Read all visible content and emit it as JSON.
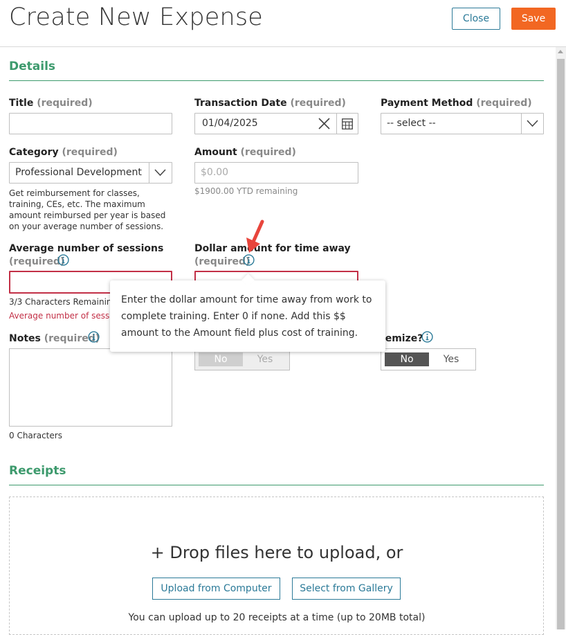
{
  "header": {
    "title": "Create New Expense",
    "close_label": "Close",
    "save_label": "Save"
  },
  "sections": {
    "details": "Details",
    "receipts": "Receipts"
  },
  "required_suffix": "(required)",
  "fields": {
    "title": {
      "label": "Title",
      "value": ""
    },
    "transaction_date": {
      "label": "Transaction Date",
      "value": "01/04/2025"
    },
    "payment_method": {
      "label": "Payment Method",
      "value": "-- select --"
    },
    "category": {
      "label": "Category",
      "value": "Professional Development",
      "help": "Get reimbursement for classes, training, CEs, etc. The maximum amount reimbursed per year is based on your average number of sessions."
    },
    "amount": {
      "label": "Amount",
      "placeholder": "$0.00",
      "remaining": "$1900.00 YTD remaining"
    },
    "avg_sessions": {
      "label": "Average number of sessions",
      "value": "",
      "char_count": "3/3 Characters Remaining",
      "error": "Average number of sessio"
    },
    "dollar_time_away": {
      "label": "Dollar amount for time away",
      "value": ""
    },
    "notes": {
      "label": "Notes",
      "value": "",
      "char_count": "0 Characters"
    },
    "toggle_middle": {
      "no": "No",
      "yes": "Yes",
      "selected": "No"
    },
    "itemize": {
      "label": "temize?",
      "no": "No",
      "yes": "Yes",
      "selected": "No"
    }
  },
  "tooltip": {
    "text": "Enter the dollar amount for time away from work to complete training. Enter 0 if none. Add this $$ amount to the Amount field plus cost of training."
  },
  "receipts": {
    "drop_text": "+ Drop files here to upload, or",
    "upload_button": "Upload from Computer",
    "gallery_button": "Select from Gallery",
    "note": "You can upload up to 20 receipts at a time (up to 20MB total)"
  },
  "colors": {
    "accent_green": "#3d9a6d",
    "save_orange": "#f26722",
    "link_blue": "#2b7a98",
    "error_red": "#c22f46",
    "pointer_arrow": "#e8453c"
  },
  "icons": [
    "clear-x-icon",
    "calendar-icon",
    "chevron-down-icon",
    "info-icon",
    "pointer-arrow-icon"
  ]
}
